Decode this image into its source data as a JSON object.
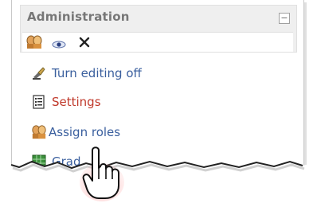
{
  "block": {
    "title": "Administration",
    "collapse_icon": "minus-box-icon",
    "header_icons": [
      "assign-roles-icon",
      "eye-icon",
      "close-icon"
    ]
  },
  "menu": {
    "items": [
      {
        "label": "Turn editing off",
        "icon": "edit-hand-icon"
      },
      {
        "label": "Settings",
        "icon": "settings-document-icon"
      },
      {
        "label": "Assign roles",
        "icon": "assign-roles-icon"
      },
      {
        "label": "Grad",
        "icon": "grades-table-icon"
      }
    ]
  },
  "colors": {
    "link": "#3a5f9e",
    "active_link": "#c0392b",
    "header_bg": "#efefef"
  },
  "cursor": "pointer-hand-cursor"
}
